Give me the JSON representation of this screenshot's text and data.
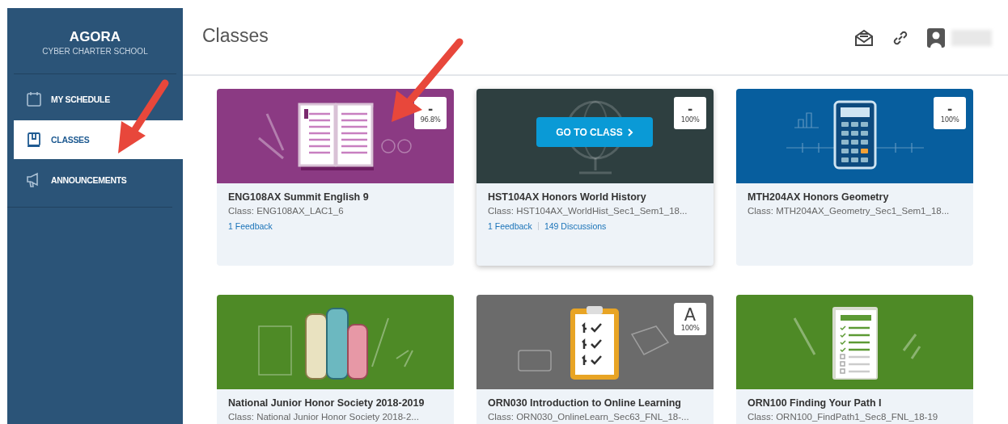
{
  "sidebar": {
    "brand": "AGORA",
    "subtitle": "CYBER CHARTER SCHOOL",
    "items": [
      {
        "label": "MY SCHEDULE",
        "kind": "calendar",
        "selected": false
      },
      {
        "label": "CLASSES",
        "kind": "book",
        "selected": true
      },
      {
        "label": "ANNOUNCEMENTS",
        "kind": "megaphone",
        "selected": false
      }
    ]
  },
  "header": {
    "title": "Classes"
  },
  "classes": [
    {
      "title": "ENG108AX Summit English 9",
      "class": "Class: ENG108AX_LAC1_6",
      "grade": "-",
      "percent": "96.8%",
      "color": "#8b3a83",
      "kind": "book",
      "hovered": false,
      "links": [
        "1 Feedback"
      ]
    },
    {
      "title": "HST104AX Honors World History",
      "class": "Class: HST104AX_WorldHist_Sec1_Sem1_18...",
      "grade": "-",
      "percent": "100%",
      "color": "#2e3f40",
      "kind": "globe",
      "hovered": true,
      "action": "GO TO CLASS",
      "links": [
        "1 Feedback",
        "149 Discussions"
      ]
    },
    {
      "title": "MTH204AX Honors Geometry",
      "class": "Class: MTH204AX_Geometry_Sec1_Sem1_18...",
      "grade": "-",
      "percent": "100%",
      "color": "#075e9e",
      "kind": "calculator",
      "hovered": false
    },
    {
      "title": "National Junior Honor Society 2018-2019",
      "class": "Class: National Junior Honor Society 2018-2...",
      "color": "#4e8a26",
      "kind": "books",
      "hovered": false
    },
    {
      "title": "ORN030 Introduction to Online Learning",
      "class": "Class: ORN030_OnlineLearn_Sec63_FNL_18-...",
      "grade": "A",
      "percent": "100%",
      "color": "#6b6b6b",
      "kind": "clipboard",
      "hovered": false
    },
    {
      "title": "ORN100 Finding Your Path I",
      "class": "Class: ORN100_FindPath1_Sec8_FNL_18-19",
      "color": "#4e8a26",
      "kind": "checklist",
      "hovered": false
    }
  ]
}
